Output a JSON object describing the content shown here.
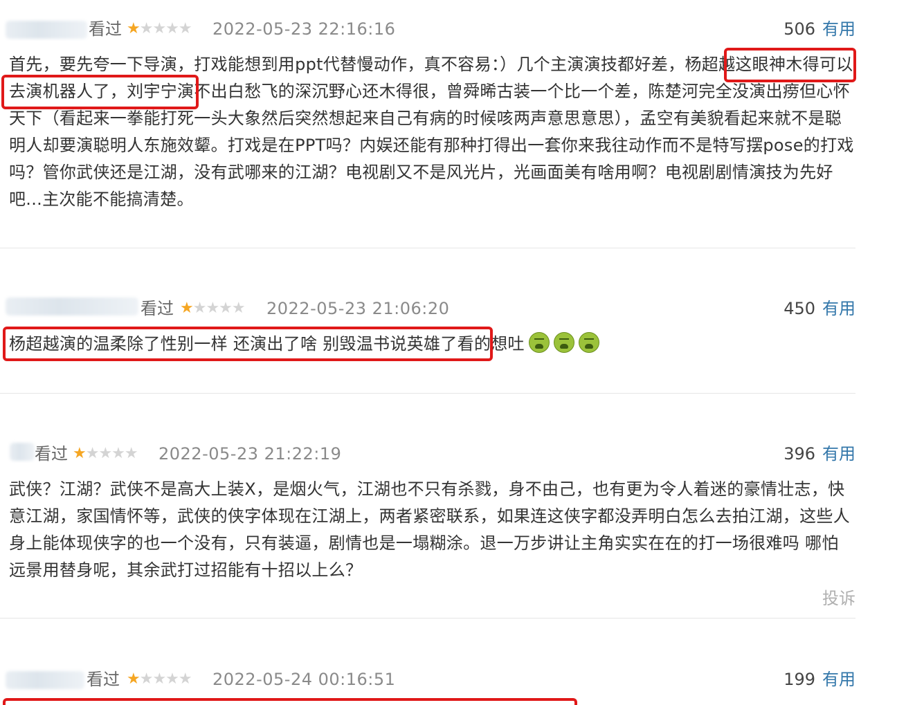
{
  "reviews": [
    {
      "seen_label": "看过",
      "stars_filled": 1,
      "stars_total": 5,
      "date": "2022-05-23 22:16:16",
      "votes": "506",
      "useful_label": "有用",
      "text": "首先，要先夸一下导演，打戏能想到用ppt代替慢动作，真不容易：）几个主演演技都好差，杨超越这眼神木得可以去演机器人了，刘宇宁演不出白愁飞的深沉野心还木得很，曾舜晞古装一个比一个差，陈楚河完全没演出痨但心怀天下（看起来一拳能打死一头大象然后突然想起来自己有病的时候咳两声意思意思），孟空有美貌看起来就不是聪明人却要演聪明人东施效颦。打戏是在PPT吗？内娱还能有那种打得出一套你来我往动作而不是特写摆pose的打戏吗？管你武侠还是江湖，没有武哪来的江湖？电视剧又不是风光片，光画面美有啥用啊？电视剧剧情演技为先好吧...主次能不能搞清楚。"
    },
    {
      "seen_label": "看过",
      "stars_filled": 1,
      "stars_total": 5,
      "date": "2022-05-23 21:06:20",
      "votes": "450",
      "useful_label": "有用",
      "text": "杨超越演的温柔除了性别一样 还演出了啥 别毁温书说英雄了看的想吐",
      "emoji_name": "nauseated-face-icon"
    },
    {
      "seen_label": "看过",
      "stars_filled": 1,
      "stars_total": 5,
      "date": "2022-05-23 21:22:19",
      "votes": "396",
      "useful_label": "有用",
      "text": "武侠？江湖？武侠不是高大上装X，是烟火气，江湖也不只有杀戮，身不由己，也有更为令人着迷的豪情壮志，快意江湖，家国情怀等，武侠的侠字体现在江湖上，两者紧密联系，如果连这侠字都没弄明白怎么去拍江湖，这些人身上能体现侠字的也一个没有，只有装逼，剧情也是一塌糊涂。退一万步讲让主角实实在在的打一场很难吗 哪怕远景用替身呢，其余武打过招能有十招以上么？",
      "report_label": "投诉"
    },
    {
      "seen_label": "看过",
      "stars_filled": 1,
      "stars_total": 5,
      "date": "2022-05-24 00:16:51",
      "votes": "199",
      "useful_label": "有用"
    }
  ],
  "colors": {
    "highlight_box": "#e01919",
    "useful_link": "#3377aa",
    "star_on": "#f5a623",
    "star_off": "#d4d4d4"
  }
}
